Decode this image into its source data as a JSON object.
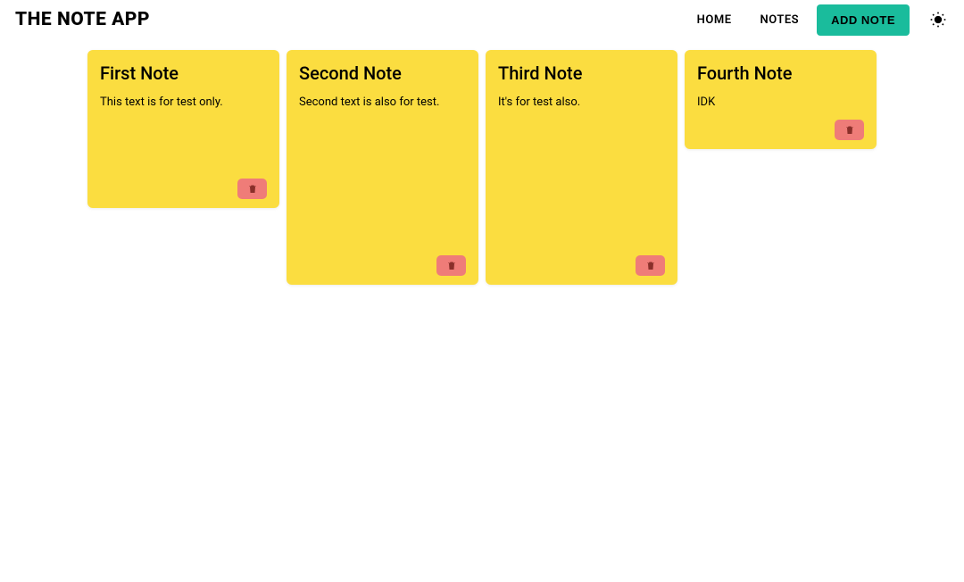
{
  "header": {
    "title": "THE NOTE APP",
    "nav": {
      "home": "HOME",
      "notes": "NOTES",
      "add_note": "ADD NOTE"
    }
  },
  "notes": [
    {
      "title": "First Note",
      "text": "This text is for test only.",
      "height_class": "h1"
    },
    {
      "title": "Second Note",
      "text": "Second text is also for test.",
      "height_class": "h2"
    },
    {
      "title": "Third Note",
      "text": "It's for test also.",
      "height_class": "h2"
    },
    {
      "title": "Fourth Note",
      "text": "IDK",
      "height_class": "h3"
    }
  ]
}
